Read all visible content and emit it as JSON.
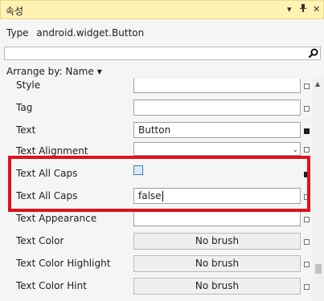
{
  "panel": {
    "title": "속성"
  },
  "titlebar_icons": {
    "dropdown": "dropdown-caret-icon",
    "pin": "pin-icon",
    "close": "close-icon"
  },
  "type_info": {
    "label": "Type",
    "value": "android.widget.Button"
  },
  "search": {
    "value": "",
    "placeholder": ""
  },
  "arrange": {
    "label": "Arrange by: Name"
  },
  "properties": [
    {
      "name": "Style",
      "value": ""
    },
    {
      "name": "Tag",
      "value": ""
    },
    {
      "name": "Text",
      "value": "Button"
    },
    {
      "name": "Text Alignment",
      "value": ""
    },
    {
      "name": "Text All Caps",
      "value": ""
    },
    {
      "name": "Text All Caps",
      "value": "false"
    },
    {
      "name": "Text Appearance",
      "value": ""
    },
    {
      "name": "Text Color",
      "value": "No brush"
    },
    {
      "name": "Text Color Highlight",
      "value": "No brush"
    },
    {
      "name": "Text Color Hint",
      "value": "No brush"
    }
  ],
  "colors": {
    "titlebar_bg": "#fff3b3",
    "highlight_border": "#e01020"
  }
}
